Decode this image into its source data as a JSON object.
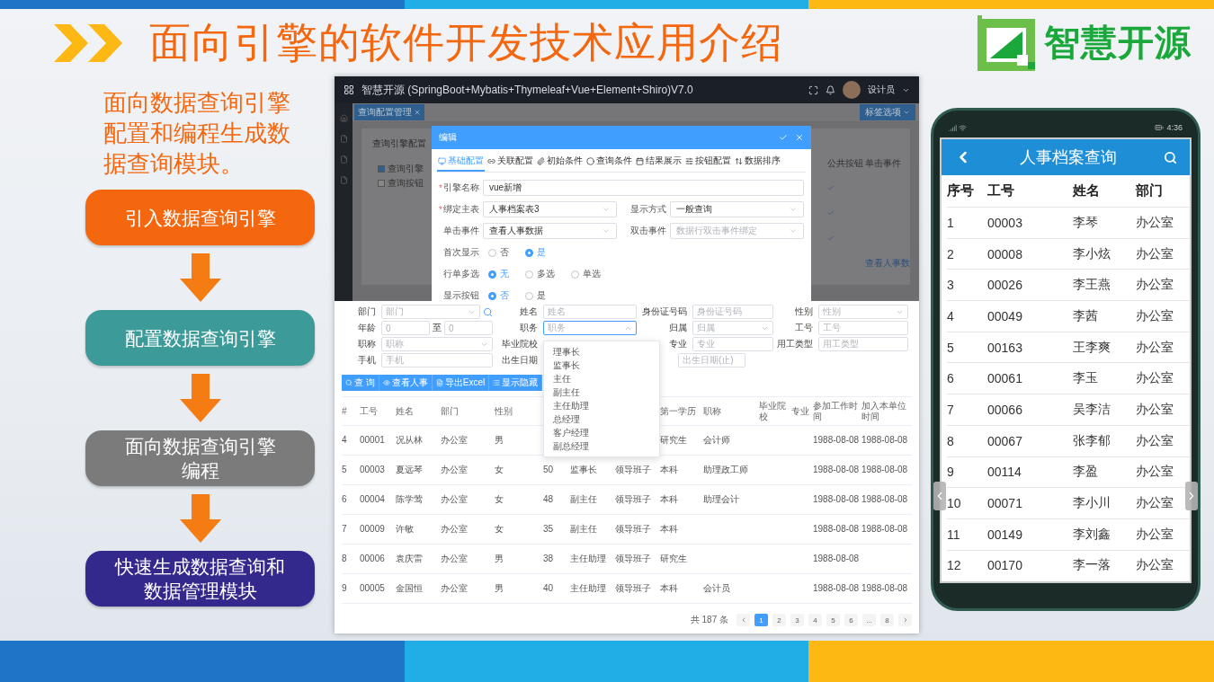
{
  "slide": {
    "title": "面向引擎的软件开发技术应用介绍",
    "logo_text": "智慧开源",
    "intro": "面向数据查询引擎配置和编程生成数据查询模块。",
    "steps": [
      {
        "lines": [
          "引入数据查询引擎"
        ],
        "color": "#f4670f"
      },
      {
        "lines": [
          "配置数据查询引擎"
        ],
        "color": "#3c9a98"
      },
      {
        "lines": [
          "面向数据查询引擎",
          "编程"
        ],
        "color": "#7b7b7b"
      },
      {
        "lines": [
          "快速生成数据查询和",
          "数据管理模块"
        ],
        "color": "#33288c"
      }
    ]
  },
  "config_app": {
    "title": "智慧开源 (SpringBoot+Mybatis+Thymeleaf+Vue+Element+Shiro)V7.0",
    "user": "设计员",
    "page_tab": "查询配置管理",
    "tab_options_button": "标签选项",
    "panel_title": "查询引擎配置",
    "panel_items": [
      {
        "label": "查询引擎",
        "checked": true
      },
      {
        "label": "查询按钮",
        "checked": false
      }
    ],
    "panel_columns": [
      "公共按钮",
      "单击事件"
    ],
    "panel_rows": [
      {
        "checked": true
      },
      {
        "checked": true
      },
      {
        "checked": true
      },
      {
        "checked": false,
        "click_event": "查看人事数"
      }
    ],
    "dialog": {
      "title": "编辑",
      "tabs": [
        {
          "label": "基础配置",
          "selected": true
        },
        {
          "label": "关联配置",
          "selected": false
        },
        {
          "label": "初始条件",
          "selected": false
        },
        {
          "label": "查询条件",
          "selected": false
        },
        {
          "label": "结果展示",
          "selected": false
        },
        {
          "label": "按钮配置",
          "selected": false
        },
        {
          "label": "数据排序",
          "selected": false
        }
      ],
      "rows": [
        [
          {
            "kind": "input",
            "label": "引擎名称",
            "required_mark": "*",
            "value": "vue新增"
          }
        ],
        [
          {
            "kind": "select",
            "label": "绑定主表",
            "required_mark": "*",
            "value": "人事档案表3"
          },
          {
            "kind": "select",
            "label": "显示方式",
            "value": "一般查询"
          }
        ],
        [
          {
            "kind": "select",
            "label": "单击事件",
            "value": "查看人事数据"
          },
          {
            "kind": "select",
            "label": "双击事件",
            "placeholder": "数据行双击事件绑定"
          }
        ],
        [
          {
            "kind": "radio",
            "label": "首次显示",
            "options": [
              {
                "label": "否",
                "selected": false
              },
              {
                "label": "是",
                "selected": true
              }
            ]
          }
        ],
        [
          {
            "kind": "radio",
            "label": "行单多选",
            "options": [
              {
                "label": "无",
                "selected": true
              },
              {
                "label": "多选",
                "selected": false
              },
              {
                "label": "单选",
                "selected": false
              }
            ]
          }
        ],
        [
          {
            "kind": "radio",
            "label": "显示按钮",
            "options": [
              {
                "label": "否",
                "selected": true
              },
              {
                "label": "是",
                "selected": false
              }
            ]
          }
        ]
      ]
    }
  },
  "search_app": {
    "form": [
      {
        "kind": "select",
        "label": "部门",
        "placeholder": "部门",
        "search": true
      },
      {
        "kind": "input",
        "label": "姓名",
        "placeholder": "姓名"
      },
      {
        "kind": "input",
        "label": "身份证号码",
        "placeholder": "身份证号码"
      },
      {
        "kind": "select",
        "label": "性别",
        "placeholder": "性别"
      },
      {
        "kind": "range",
        "label": "年龄",
        "from_value": "0",
        "separator": "至",
        "to_value": "0"
      },
      {
        "kind": "select",
        "label": "职务",
        "placeholder": "职务",
        "open": true,
        "options": [
          "理事长",
          "监事长",
          "主任",
          "副主任",
          "主任助理",
          "总经理",
          "客户经理",
          "副总经理"
        ]
      },
      {
        "kind": "select",
        "label": "归属",
        "placeholder": "归属"
      },
      {
        "kind": "input",
        "label": "工号",
        "placeholder": "工号"
      },
      {
        "kind": "select",
        "label": "职称",
        "placeholder": "职称"
      },
      {
        "kind": "covered",
        "label": "毕业院校"
      },
      {
        "kind": "input",
        "label": "专业",
        "placeholder": "专业"
      },
      {
        "kind": "input",
        "label": "用工类型",
        "placeholder": "用工类型"
      },
      {
        "kind": "input",
        "label": "手机",
        "placeholder": "手机"
      },
      {
        "kind": "date_end",
        "label": "出生日期",
        "placeholder": "出生日期(止)"
      }
    ],
    "buttons": [
      {
        "kind": "search",
        "label": "查 询"
      },
      {
        "kind": "view",
        "label": "查看人事"
      },
      {
        "kind": "export",
        "label": "导出Excel"
      },
      {
        "kind": "toggle",
        "label": "显示隐藏"
      }
    ],
    "columns": [
      "#",
      "工号",
      "姓名",
      "部门",
      "性别",
      null,
      null,
      null,
      "第一学历",
      "职称",
      "毕业院校",
      "专业",
      "参加工作时间",
      "加入本单位时间"
    ],
    "rows": [
      [
        "4",
        "00001",
        "况从林",
        "办公室",
        "男",
        null,
        null,
        null,
        "研究生",
        "会计师",
        null,
        null,
        "1988-08-08",
        "1988-08-08"
      ],
      [
        "5",
        "00003",
        "夏远琴",
        "办公室",
        "女",
        "50",
        "监事长",
        "领导班子",
        "本科",
        "助理政工师",
        null,
        null,
        "1988-08-08",
        "1988-08-08"
      ],
      [
        "6",
        "00004",
        "陈学莺",
        "办公室",
        "女",
        "48",
        "副主任",
        "领导班子",
        "本科",
        "助理会计",
        null,
        null,
        "1988-08-08",
        "1988-08-08"
      ],
      [
        "7",
        "00009",
        "许敏",
        "办公室",
        "女",
        "35",
        "副主任",
        "领导班子",
        "本科",
        null,
        null,
        null,
        "1988-08-08",
        "1988-08-08"
      ],
      [
        "8",
        "00006",
        "袁庆雷",
        "办公室",
        "男",
        "38",
        "主任助理",
        "领导班子",
        "研究生",
        null,
        null,
        null,
        "1988-08-08",
        null
      ],
      [
        "9",
        "00005",
        "金国恒",
        "办公室",
        "男",
        "40",
        "主任助理",
        "领导班子",
        "本科",
        "会计员",
        null,
        null,
        "1988-08-08",
        "1988-08-08"
      ]
    ],
    "total": "共 187 条",
    "pages": [
      {
        "label": "1",
        "selected": true
      },
      {
        "label": "2",
        "selected": false
      },
      {
        "label": "3",
        "selected": false
      },
      {
        "label": "4",
        "selected": false
      },
      {
        "label": "5",
        "selected": false
      },
      {
        "label": "6",
        "selected": false
      },
      {
        "label": "...",
        "selected": false
      },
      {
        "label": "8",
        "selected": false
      }
    ]
  },
  "phone": {
    "time": "4:36",
    "title": "人事档案查询",
    "columns": [
      "序号",
      "工号",
      "姓名",
      "部门"
    ],
    "rows": [
      [
        "1",
        "00003",
        "李琴",
        "办公室"
      ],
      [
        "2",
        "00008",
        "李小炫",
        "办公室"
      ],
      [
        "3",
        "00026",
        "李王燕",
        "办公室"
      ],
      [
        "4",
        "00049",
        "李茜",
        "办公室"
      ],
      [
        "5",
        "00163",
        "王李爽",
        "办公室"
      ],
      [
        "6",
        "00061",
        "李玉",
        "办公室"
      ],
      [
        "7",
        "00066",
        "吴李洁",
        "办公室"
      ],
      [
        "8",
        "00067",
        "张李郁",
        "办公室"
      ],
      [
        "9",
        "00114",
        "李盈",
        "办公室"
      ],
      [
        "10",
        "00071",
        "李小川",
        "办公室"
      ],
      [
        "11",
        "00149",
        "李刘鑫",
        "办公室"
      ],
      [
        "12",
        "00170",
        "李一落",
        "办公室"
      ]
    ]
  }
}
